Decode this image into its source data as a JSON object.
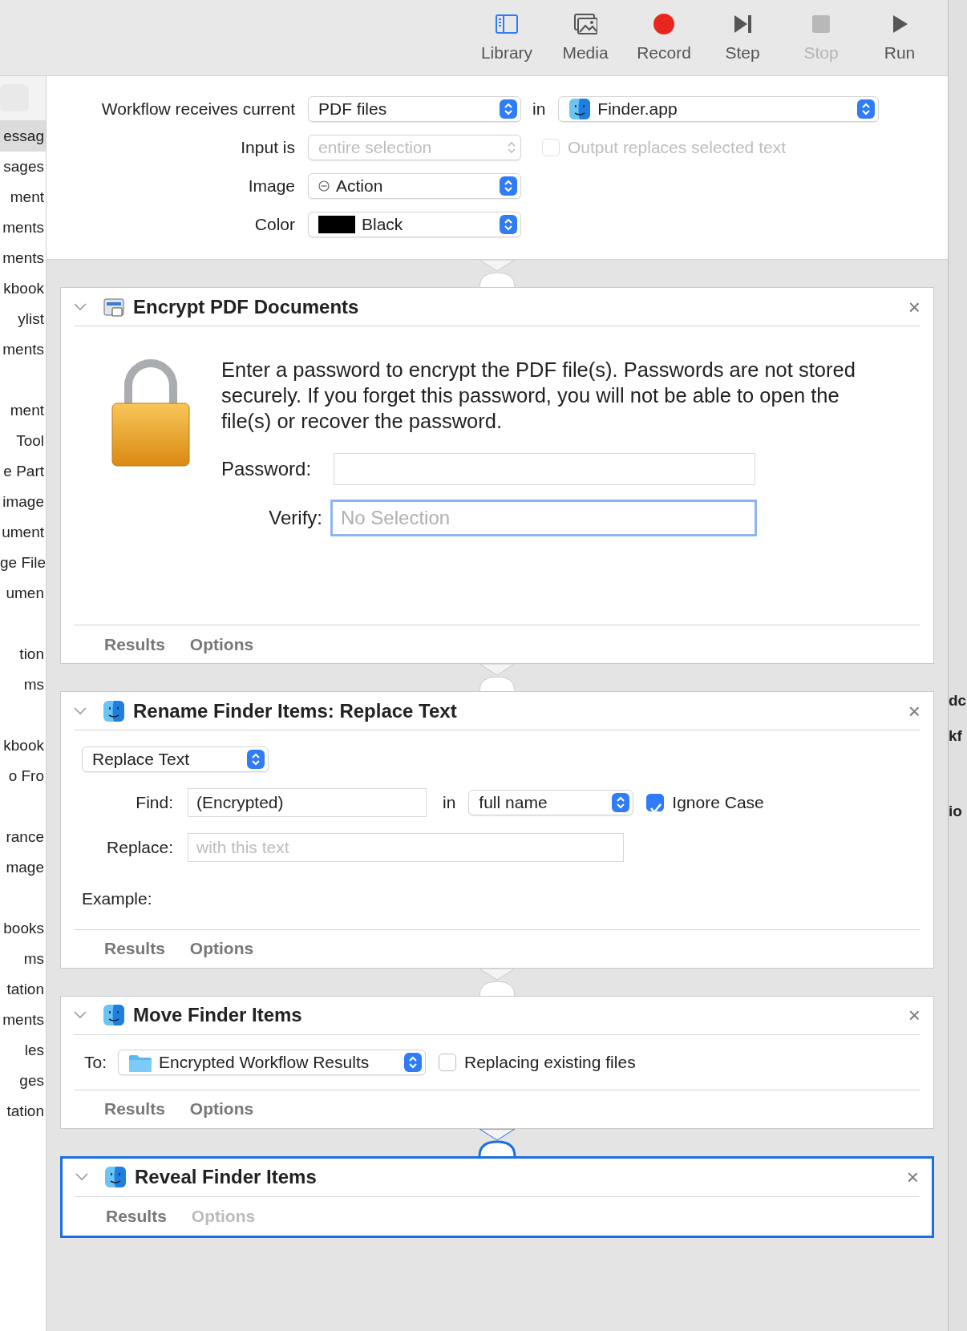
{
  "toolbar": {
    "buttons": [
      {
        "label": "Library",
        "kind": "library",
        "disabled": false
      },
      {
        "label": "Media",
        "kind": "media",
        "disabled": false
      },
      {
        "label": "Record",
        "kind": "record",
        "disabled": false
      },
      {
        "label": "Step",
        "kind": "step",
        "disabled": false
      },
      {
        "label": "Stop",
        "kind": "stop",
        "disabled": true
      },
      {
        "label": "Run",
        "kind": "run",
        "disabled": false
      }
    ]
  },
  "sidebar": {
    "groups": [
      [
        {
          "label": "essag",
          "selected": true
        },
        {
          "label": "sages",
          "selected": false
        },
        {
          "label": "ment",
          "selected": false
        },
        {
          "label": "ments",
          "selected": false
        },
        {
          "label": "ments",
          "selected": false
        },
        {
          "label": "kbook",
          "selected": false
        },
        {
          "label": "ylist",
          "selected": false
        },
        {
          "label": "ments",
          "selected": false
        }
      ],
      [
        {
          "label": "ment",
          "selected": false
        },
        {
          "label": "Tool",
          "selected": false
        },
        {
          "label": "e Part",
          "selected": false
        },
        {
          "label": "image",
          "selected": false
        },
        {
          "label": "ument",
          "selected": false
        },
        {
          "label": "ge File",
          "selected": false
        },
        {
          "label": "umen",
          "selected": false
        }
      ],
      [
        {
          "label": "tion",
          "selected": false
        },
        {
          "label": "ms",
          "selected": false
        }
      ],
      [
        {
          "label": "kbook",
          "selected": false
        },
        {
          "label": "o Fro",
          "selected": false
        }
      ],
      [
        {
          "label": "rance",
          "selected": false
        },
        {
          "label": "mage",
          "selected": false
        }
      ],
      [
        {
          "label": "books",
          "selected": false
        },
        {
          "label": "ms",
          "selected": false
        },
        {
          "label": "tation",
          "selected": false
        },
        {
          "label": "ments",
          "selected": false
        },
        {
          "label": "les",
          "selected": false
        },
        {
          "label": "ges",
          "selected": false
        },
        {
          "label": "tation",
          "selected": false
        }
      ]
    ]
  },
  "workflow": {
    "receives_label": "Workflow receives current",
    "receives_value": "PDF files",
    "in_label": "in",
    "app": "Finder.app",
    "input_label": "Input is",
    "input_value": "entire selection",
    "input_disabled": true,
    "output_replaces": {
      "label": "Output replaces selected text",
      "checked": false,
      "disabled": true
    },
    "image_label": "Image",
    "image_value": "Action",
    "color_label": "Color",
    "color_value": "Black",
    "color": "#000000"
  },
  "actions": [
    {
      "kind": "encrypt",
      "title": "Encrypt PDF Documents",
      "close": "×",
      "selected": false,
      "description": "Enter a password to encrypt the PDF file(s). Passwords are not stored securely. If you forget this password, you will not be able to open the file(s) or recover the password.",
      "password_label": "Password:",
      "verify_label": "Verify:",
      "verify_placeholder": "No Selection",
      "verify_focused": true,
      "tabs": [
        {
          "label": "Results",
          "disabled": false
        },
        {
          "label": "Options",
          "disabled": false
        }
      ]
    },
    {
      "kind": "rename",
      "title": "Rename Finder Items: Replace Text",
      "close": "×",
      "selected": false,
      "mode": "Replace Text",
      "find_label": "Find:",
      "find_value": "(Encrypted)",
      "in_label": "in",
      "scope": "full name",
      "ignore_case": {
        "label": "Ignore Case",
        "checked": true
      },
      "replace_label": "Replace:",
      "replace_placeholder": "with this text",
      "example_label": "Example:",
      "tabs": [
        {
          "label": "Results",
          "disabled": false
        },
        {
          "label": "Options",
          "disabled": false
        }
      ]
    },
    {
      "kind": "move",
      "title": "Move Finder Items",
      "close": "×",
      "selected": false,
      "to_label": "To:",
      "folder": "Encrypted Workflow Results",
      "replacing": {
        "label": "Replacing existing files",
        "checked": false
      },
      "tabs": [
        {
          "label": "Results",
          "disabled": false
        },
        {
          "label": "Options",
          "disabled": false
        }
      ]
    },
    {
      "kind": "reveal",
      "title": "Reveal Finder Items",
      "close": "×",
      "selected": true,
      "tabs": [
        {
          "label": "Results",
          "disabled": false
        },
        {
          "label": "Options",
          "disabled": true
        }
      ]
    }
  ],
  "background_window": {
    "fragments": [
      "dc",
      "kf",
      "io"
    ]
  }
}
